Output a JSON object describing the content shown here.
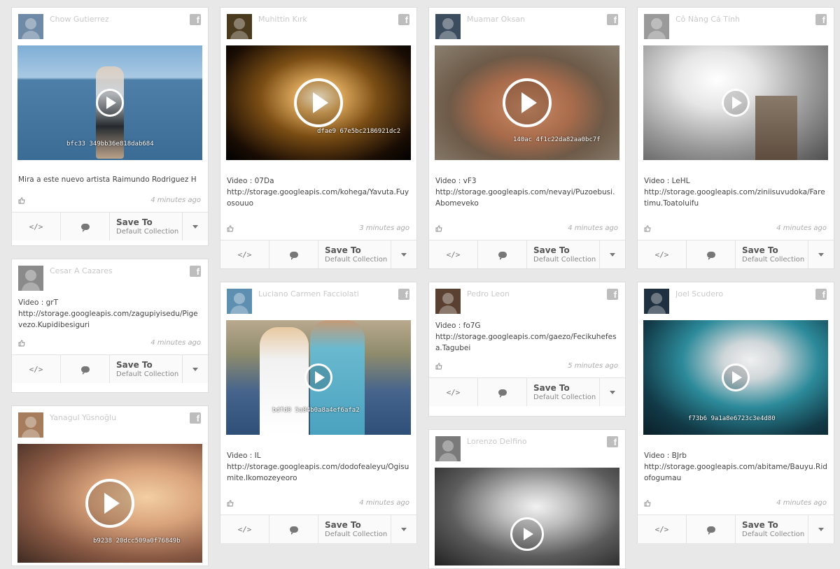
{
  "cards": [
    {
      "id": "c1",
      "author": "Chow Gutierrez",
      "media_code": "bfc33\n349bb36e818dab684",
      "description": "Mira a este nuevo artista Raimundo Rodriguez H",
      "time": "4 minutes ago"
    },
    {
      "id": "c2",
      "author": "Cesar A Cazares",
      "description": "Video : grT\nhttp://storage.googleapis.com/zagupiyisedu/Pigevezo.Kupidibesiguri",
      "time": "4 minutes ago"
    },
    {
      "id": "c3",
      "author": "Yanagul Yüsnoğlu",
      "media_code": "b9238\n20dcc509a0f76849b"
    },
    {
      "id": "c4",
      "author": "Muhittin Kırk",
      "media_code": "dfae9\n67e5bc2186921dc2",
      "description": "Video : 07Da\nhttp://storage.googleapis.com/kohega/Yavuta.Fuyosouuo",
      "time": "3 minutes ago"
    },
    {
      "id": "c5",
      "author": "Luciano Carmen Facciolati",
      "media_code": "bdfd0\n5a84b0a8a4ef6afa2",
      "description": "Video : IL\nhttp://storage.googleapis.com/dodofealeyu/Ogisumite.Ikomozeyeoro",
      "time": "4 minutes ago"
    },
    {
      "id": "c6",
      "author": "Muamar Oksan",
      "media_code": "140ac\n4f1c22da82aa0bc7f",
      "description": "Video : vF3\nhttp://storage.googleapis.com/nevayi/Puzoebusi.Abomeveko",
      "time": "4 minutes ago"
    },
    {
      "id": "c7",
      "author": "Pedro Leon",
      "description": "Video : fo7G\nhttp://storage.googleapis.com/gaezo/Fecikuhefesa.Tagubei",
      "time": "5 minutes ago"
    },
    {
      "id": "c8",
      "author": "Lorenzo Delfino"
    },
    {
      "id": "c9",
      "author": "Cô Nàng Cá Tính",
      "description": "Video : LeHL\nhttp://storage.googleapis.com/ziniisuvudoka/Faretimu.Toatoluifu",
      "time": "4 minutes ago"
    },
    {
      "id": "c10",
      "author": "Joel Scudero",
      "media_code": "f73b6\n9a1a8e6723c3e4d80",
      "description": "Video : BJrb\nhttp://storage.googleapis.com/abitame/Bauyu.Ridofogumau",
      "time": "4 minutes ago"
    }
  ],
  "actions": {
    "save_label": "Save To",
    "collection_label": "Default Collection",
    "embed_symbol": "</>"
  },
  "icons": {
    "network": "facebook-icon",
    "like": "thumbs-up-icon",
    "comment": "comment-icon",
    "embed": "code-icon",
    "play": "play-icon",
    "dropdown": "chevron-down-icon"
  },
  "colors": {
    "page_background": "#e8e8e8",
    "card_background": "#ffffff",
    "action_bar": "#fafafa",
    "muted_text": "#aaaaaa"
  }
}
